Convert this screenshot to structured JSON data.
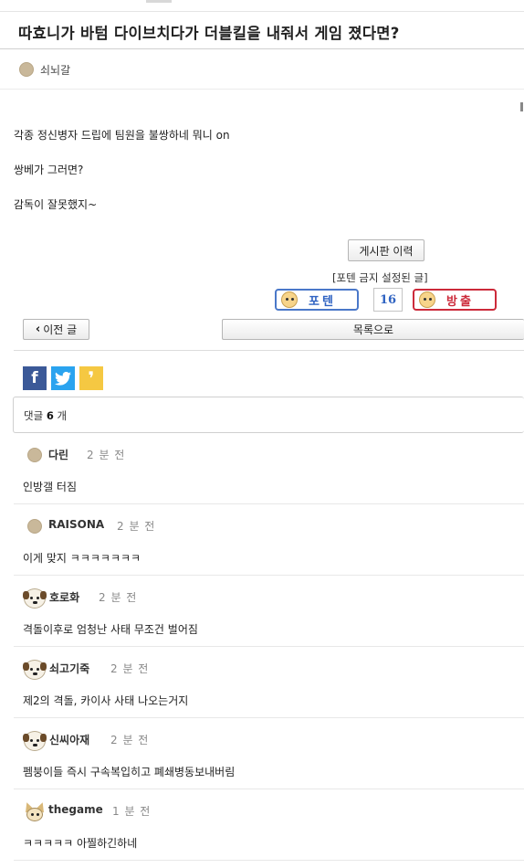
{
  "post": {
    "title": "따효니가 바텀 다이브치다가 더블킬을 내줘서 게임 졌다면?",
    "author": "쇠뇌갈",
    "body_lines": [
      "각종 정신병자 드립에 팀원을 불쌍하네 뭐니 on",
      "쌍베가 그러면?",
      "감독이 잘못했지~"
    ]
  },
  "actions": {
    "history_button": "게시판 이력",
    "ban_note": "[포텐 금지 설정된 글]",
    "upvote_label": "포텐",
    "vote_count": "16",
    "downvote_label": "방출",
    "prev_button": "이전 글",
    "list_button": "목록으로"
  },
  "share": {
    "facebook_icon": "facebook-icon",
    "twitter_icon": "twitter-icon",
    "kakao_icon": "kakaostory-icon"
  },
  "comments_header": {
    "label": "댓글",
    "count": "6",
    "unit": "개"
  },
  "comments": [
    {
      "avatar": "dot",
      "name": "다린",
      "time": "2 분 전",
      "text": "인방갤 터짐"
    },
    {
      "avatar": "dot",
      "name": "RAISONA",
      "time": "2 분 전",
      "text": "이게 맞지 ㅋㅋㅋㅋㅋㅋㅋ"
    },
    {
      "avatar": "puppy",
      "name": "호로화",
      "time": "2 분 전",
      "text": "격돌이후로 엄청난 사태 무조건 벌어짐"
    },
    {
      "avatar": "puppy",
      "name": "쇠고기죽",
      "time": "2 분 전",
      "text": "제2의 격돌, 카이사 사태 나오는거지"
    },
    {
      "avatar": "puppy",
      "name": "신씨아재",
      "time": "2 분 전",
      "text": "펨붕이들 즉시 구속복입히고 폐쇄병동보내버림"
    },
    {
      "avatar": "chihuahua",
      "name": "thegame",
      "time": "1 분 전",
      "text": "ㅋㅋㅋㅋㅋ 아찔하긴하네"
    }
  ]
}
